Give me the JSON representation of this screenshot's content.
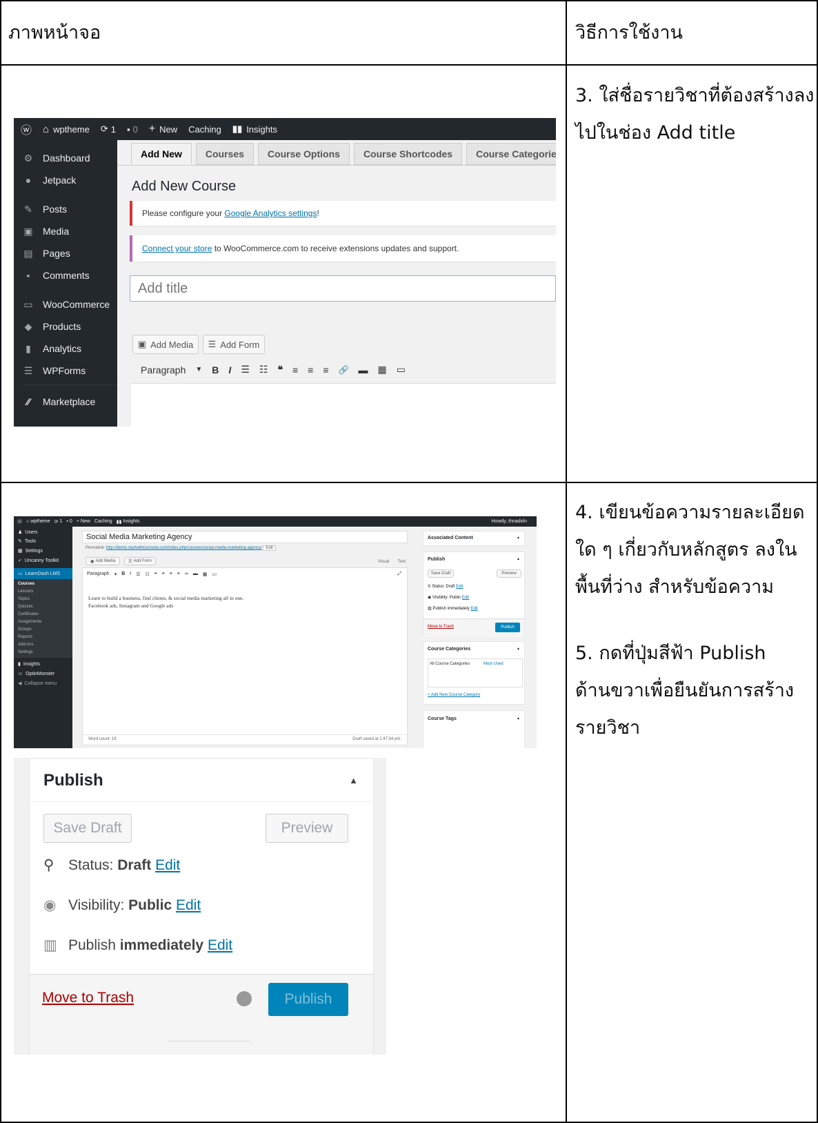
{
  "table": {
    "header_left": "ภาพหน้าจอ",
    "header_right": "วิธีการใช้งาน"
  },
  "row1": {
    "instruction_line1": "3. ใส่ชื่อรายวิชาที่ต้องสร้างลง",
    "instruction_line2": "ไปในช่อง Add title"
  },
  "row2": {
    "instruction_lines": [
      "4. เขียนข้อความรายละเอียด",
      "ใด ๆ เกี่ยวกับหลักสูตร ลงใน",
      "พื้นที่ว่าง สำหรับข้อความ",
      "5. กดที่ปุ่มสีฟ้า Publish",
      "ด้านขวาเพื่อยืนยันการสร้าง",
      "รายวิชา"
    ]
  },
  "shot1": {
    "adminbar": {
      "site": "wptheme",
      "updates": "1",
      "comments": "0",
      "new": "New",
      "caching": "Caching",
      "insights": "Insights"
    },
    "sidebar": [
      {
        "label": "Dashboard",
        "icon": "dashboard-icon",
        "glyph": "⚙"
      },
      {
        "label": "Jetpack",
        "icon": "jetpack-icon",
        "glyph": "●"
      },
      {
        "label": "Posts",
        "icon": "pin-icon",
        "glyph": "✎"
      },
      {
        "label": "Media",
        "icon": "media-icon",
        "glyph": "▣"
      },
      {
        "label": "Pages",
        "icon": "pages-icon",
        "glyph": "▤"
      },
      {
        "label": "Comments",
        "icon": "comment-icon",
        "glyph": "▪"
      },
      {
        "label": "WooCommerce",
        "icon": "woo-icon",
        "glyph": "▭"
      },
      {
        "label": "Products",
        "icon": "products-icon",
        "glyph": "◆"
      },
      {
        "label": "Analytics",
        "icon": "analytics-icon",
        "glyph": "▮"
      },
      {
        "label": "WPForms",
        "icon": "forms-icon",
        "glyph": "☰"
      },
      {
        "label": "Marketplace",
        "icon": "marketplace-icon",
        "glyph": "⁄⁄"
      }
    ],
    "tabs": [
      "Add New",
      "Courses",
      "Course Options",
      "Course Shortcodes",
      "Course Categories"
    ],
    "page_title": "Add New Course",
    "notice1_prefix": "Please configure your ",
    "notice1_link": "Google Analytics settings",
    "notice1_suffix": "!",
    "notice2_link": "Connect your store",
    "notice2_suffix": " to WooCommerce.com to receive extensions updates and support.",
    "title_placeholder": "Add title",
    "add_media": "Add Media",
    "add_form": "Add Form",
    "paragraph": "Paragraph",
    "toolbar_glyphs": [
      "B",
      "I",
      "☰",
      "☷",
      "❝",
      "≡",
      "≡",
      "≡",
      "🔗",
      "▬",
      "▦",
      "▭"
    ]
  },
  "shot2": {
    "adminbar": {
      "site": "wptheme",
      "updates": "1",
      "comments": "0",
      "new": "New",
      "caching": "Caching",
      "insights": "Insights",
      "howdy": "Howdy, thnadoln"
    },
    "sidebar": [
      "Users",
      "Tools",
      "Settings",
      "Uncanny Toolkit"
    ],
    "learndash": "LearnDash LMS",
    "submenu": [
      "Courses",
      "Lessons",
      "Topics",
      "Quizzes",
      "Certificates",
      "Assignments",
      "Groups",
      "Reports",
      "Add-ons",
      "Settings"
    ],
    "sidebar_bottom": [
      "Insights",
      "OptinMonster",
      "Collapse menu"
    ],
    "post_title": "Social Media Marketing Agency",
    "permalink_label": "Permalink:",
    "permalink_url": "http://demo.startwithcuriosity.com/index.php/courses/social-media-marketing-agency/",
    "permalink_edit": "Edit",
    "add_media": "Add Media",
    "add_form": "Add Form",
    "visual": "Visual",
    "text_tab": "Text",
    "paragraph": "Paragraph",
    "content_line1": "Learn to build a business, find clients, & social media marketing all in one.",
    "content_line2": "Facebook ads, Instagram and Google ads",
    "word_count": "Word count: 19",
    "draft_saved": "Draft saved at 1:47:34 pm.",
    "associated": "Associated Content",
    "publish": "Publish",
    "save_draft": "Save Draft",
    "preview": "Preview",
    "status": "Status: Draft",
    "visibility": "Visibility: Public",
    "publish_immediately": "Publish immediately",
    "edit": "Edit",
    "move_to_trash": "Move to Trash",
    "publish_button": "Publish",
    "course_categories": "Course Categories",
    "all_categories": "All Course Categories",
    "most_used": "Most Used",
    "add_category": "+ Add New Course Category",
    "course_tags": "Course Tags"
  },
  "shot3": {
    "title": "Publish",
    "save_draft": "Save Draft",
    "preview": "Preview",
    "status_label": "Status: ",
    "status_value": "Draft",
    "visibility_label": "Visibility: ",
    "visibility_value": "Public",
    "publish_label": "Publish ",
    "publish_value": "immediately",
    "edit": "Edit",
    "move_to_trash": "Move to Trash",
    "publish_button": "Publish"
  }
}
